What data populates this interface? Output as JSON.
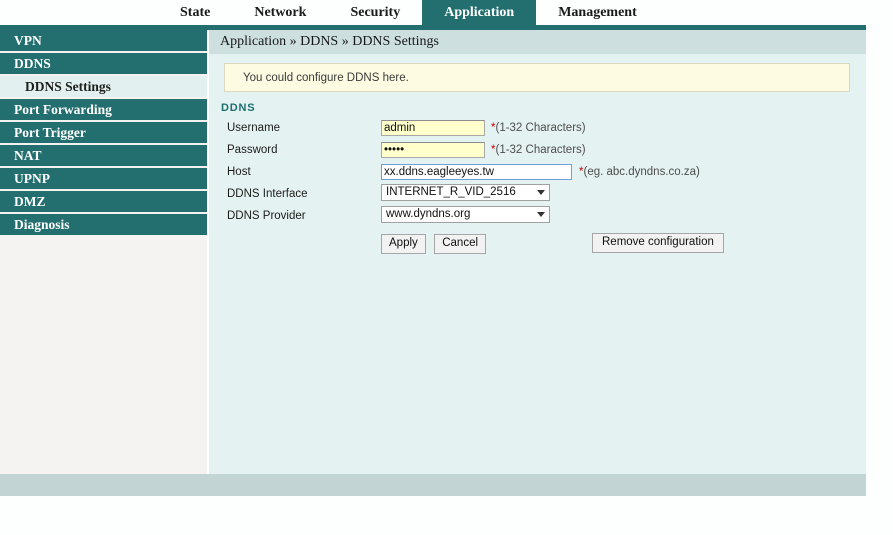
{
  "topnav": {
    "items": [
      {
        "label": "State",
        "active": false
      },
      {
        "label": "Network",
        "active": false
      },
      {
        "label": "Security",
        "active": false
      },
      {
        "label": "Application",
        "active": true
      },
      {
        "label": "Management",
        "active": false
      }
    ]
  },
  "sidebar": {
    "items": [
      {
        "label": "VPN",
        "type": "main"
      },
      {
        "label": "DDNS",
        "type": "main"
      },
      {
        "label": "DDNS Settings",
        "type": "sub"
      },
      {
        "label": "Port Forwarding",
        "type": "main"
      },
      {
        "label": "Port Trigger",
        "type": "main"
      },
      {
        "label": "NAT",
        "type": "main"
      },
      {
        "label": "UPNP",
        "type": "main"
      },
      {
        "label": "DMZ",
        "type": "main"
      },
      {
        "label": "Diagnosis",
        "type": "main"
      }
    ]
  },
  "breadcrumb": "Application » DDNS » DDNS Settings",
  "notice": "You could configure DDNS here.",
  "section": {
    "title": "DDNS",
    "fields": {
      "username": {
        "label": "Username",
        "value": "admin",
        "hint_star": "*",
        "hint": "(1-32 Characters)"
      },
      "password": {
        "label": "Password",
        "value": "•••••",
        "hint_star": "*",
        "hint": "(1-32 Characters)"
      },
      "host": {
        "label": "Host",
        "value": "xx.ddns.eagleeyes.tw",
        "hint_star": "*",
        "hint": "(eg. abc.dyndns.co.za)"
      },
      "ddns_interface": {
        "label": "DDNS Interface",
        "value": "INTERNET_R_VID_2516",
        "icon": "chevron-down-icon"
      },
      "ddns_provider": {
        "label": "DDNS Provider",
        "value": "www.dyndns.org",
        "icon": "chevron-down-icon"
      }
    }
  },
  "buttons": {
    "apply": "Apply",
    "cancel": "Cancel",
    "remove": "Remove configuration"
  },
  "colors": {
    "teal": "#236e6e",
    "panel": "#e4f2f1",
    "breadcrumb_bar": "#cddfde",
    "notice_bg": "#fdfce2",
    "input_yellow": "#ffffcc",
    "required_star": "#cc0000",
    "footer": "#c2d4d4"
  }
}
